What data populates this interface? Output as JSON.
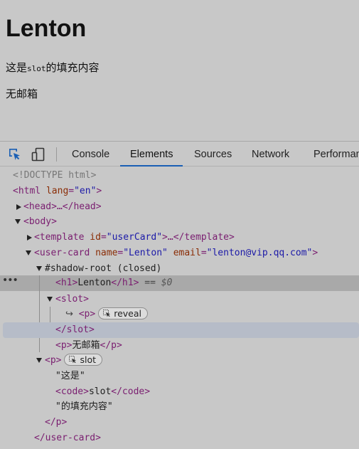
{
  "page": {
    "heading": "Lenton",
    "line1_prefix": "这是",
    "line1_code": "slot",
    "line1_suffix": "的填充内容",
    "line2": "无邮箱"
  },
  "devtools": {
    "tabs": [
      "Console",
      "Elements",
      "Sources",
      "Network",
      "Performan"
    ],
    "active_tab": "Elements",
    "tree": {
      "doctype": "<!DOCTYPE html>",
      "html_open": "<html ",
      "html_attr": "lang",
      "html_val": "\"en\"",
      "html_close": ">",
      "head": "<head>…</head>",
      "body": "<body>",
      "template_open": "<template ",
      "template_attr": "id",
      "template_val": "\"userCard\"",
      "template_close": ">…</template>",
      "usercard_open": "<user-card ",
      "usercard_attr1": "name",
      "usercard_val1": "\"Lenton\"",
      "usercard_attr2": "email",
      "usercard_val2": "\"lenton@vip.qq.com\"",
      "usercard_close": ">",
      "shadow_root": "#shadow-root (closed)",
      "h1_open": "<h1>",
      "h1_text": "Lenton",
      "h1_close": "</h1>",
      "h1_eq": " == ",
      "h1_dollar": "$0",
      "slot_open": "<slot>",
      "slot_ref": "<p>",
      "reveal_badge": "reveal",
      "slot_close": "</slot>",
      "p_open": "<p>",
      "p_text": "无邮箱",
      "p_close": "</p>",
      "p2_open": "<p>",
      "slot_badge": "slot",
      "text1": "\"这是\"",
      "code_open": "<code>",
      "code_text": "slot",
      "code_close": "</code>",
      "text2": "\"的填充内容\"",
      "p2_close": "</p>",
      "usercard_end": "</user-card>"
    }
  }
}
